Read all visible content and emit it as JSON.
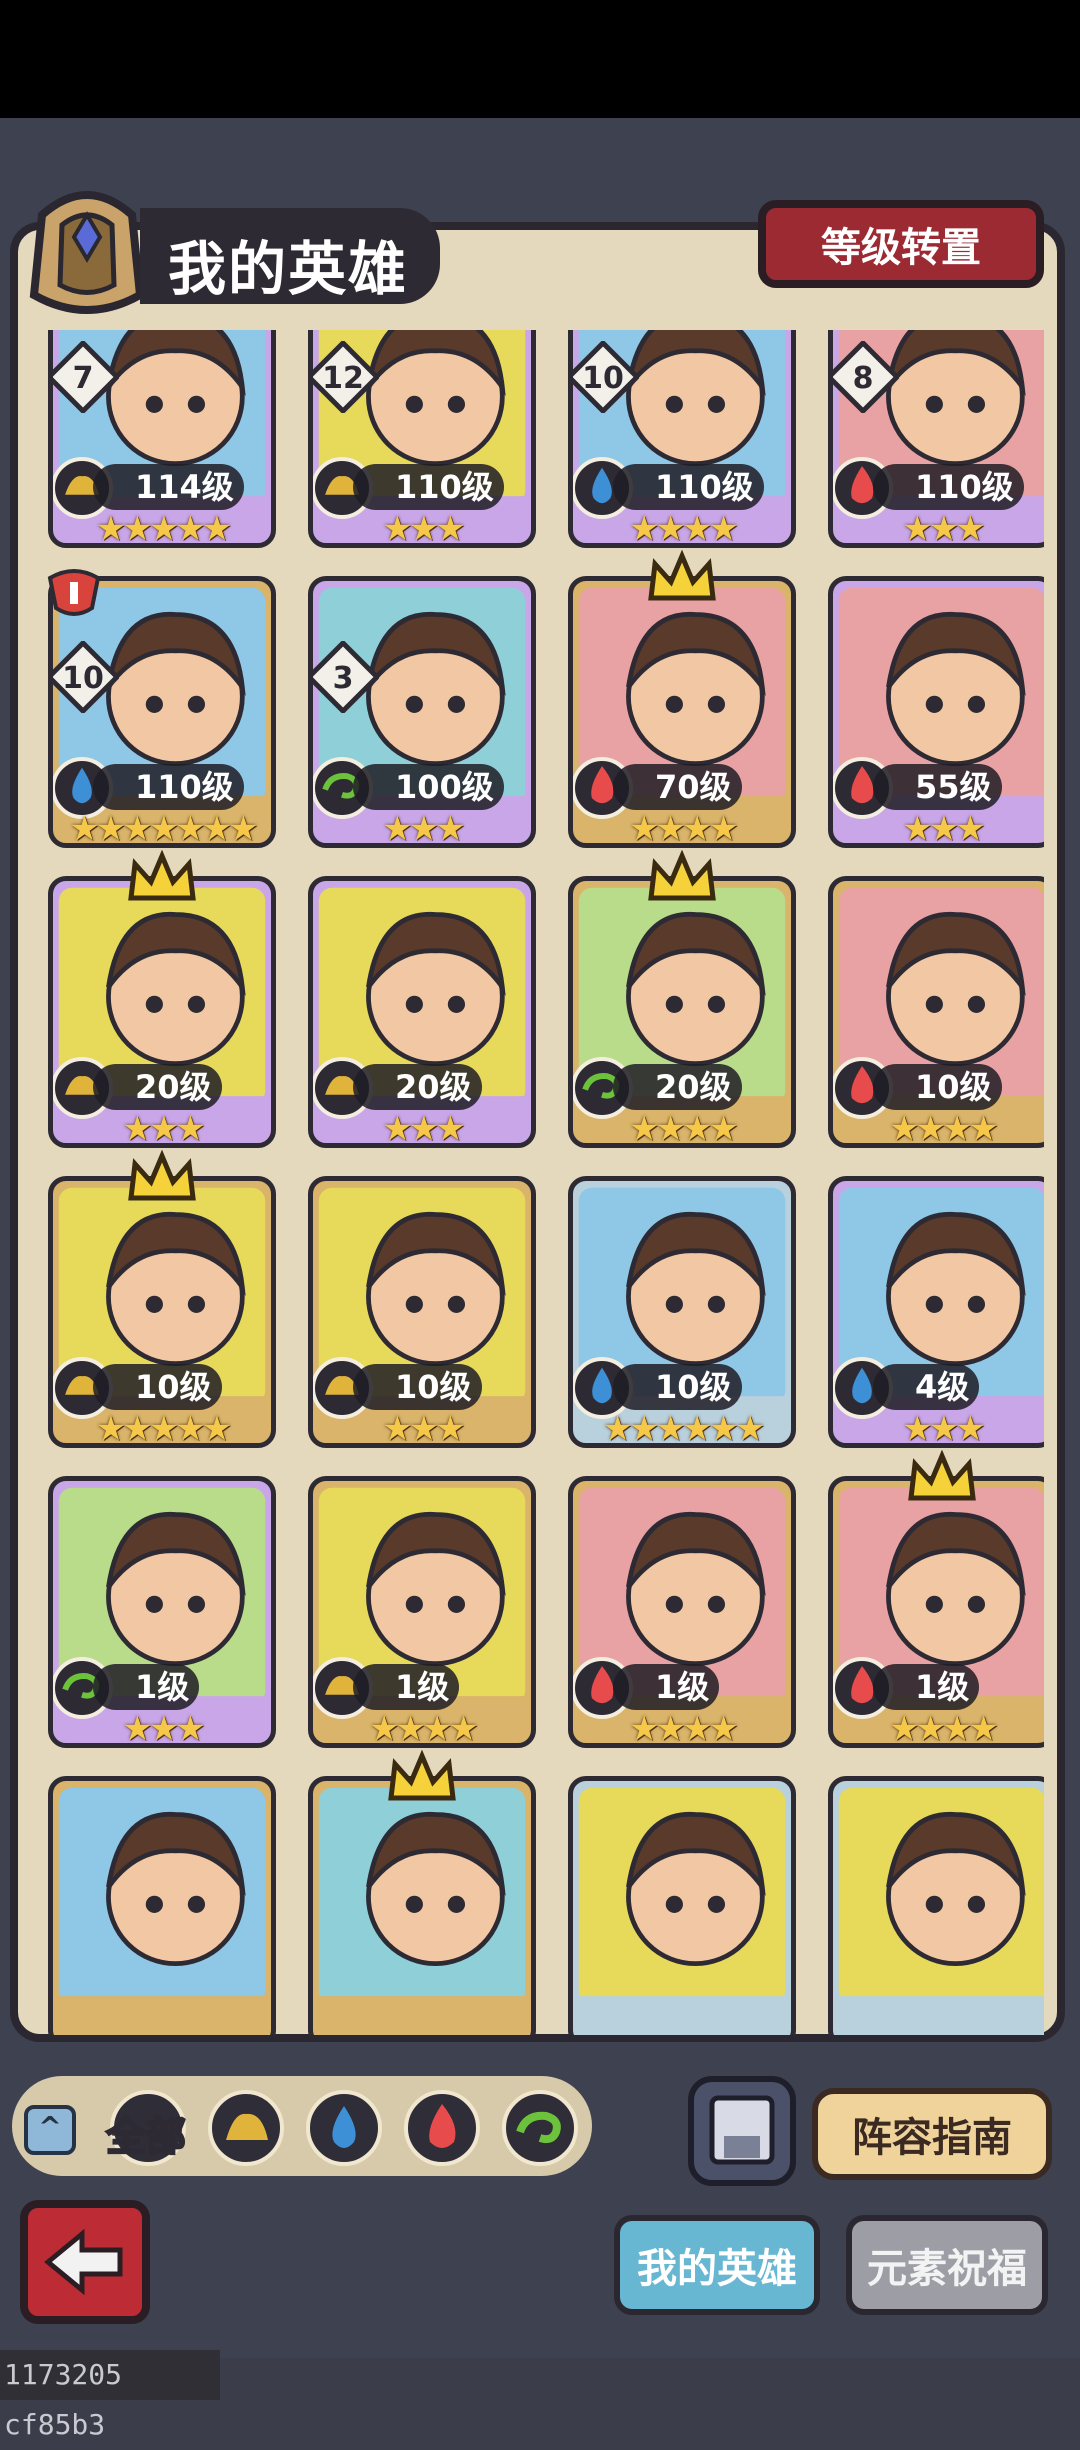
{
  "header": {
    "title": "我的英雄",
    "transfer_button": "等级转置"
  },
  "colors": {
    "fire": "#e84b4b",
    "water": "#3d8fd6",
    "earth": "#e0b33a",
    "wind": "#6cc23a"
  },
  "heroes": [
    {
      "level": "114级",
      "elem": "earth",
      "stars": "★★★★★",
      "num": "7",
      "crown": false,
      "dot": true,
      "rank": false,
      "bg": "#8fc7e6",
      "frame": "#c9a6e8"
    },
    {
      "level": "110级",
      "elem": "earth",
      "stars": "★★★",
      "num": "12",
      "crown": true,
      "dot": true,
      "rank": true,
      "bg": "#e7d95a",
      "frame": "#c9a6e8"
    },
    {
      "level": "110级",
      "elem": "water",
      "stars": "★★★★",
      "num": "10",
      "crown": false,
      "dot": true,
      "rank": false,
      "bg": "#8fc7e6",
      "frame": "#c9a6e8"
    },
    {
      "level": "110级",
      "elem": "fire",
      "stars": "★★★",
      "num": "8",
      "crown": true,
      "dot": true,
      "rank": false,
      "bg": "#e9a2a4",
      "frame": "#c9a6e8"
    },
    {
      "level": "110级",
      "elem": "water",
      "stars": "★★★★★★★",
      "num": "10",
      "crown": false,
      "dot": false,
      "rank": true,
      "bg": "#8fc7e6",
      "frame": "#d9b46a"
    },
    {
      "level": "100级",
      "elem": "wind",
      "stars": "★★★",
      "num": "3",
      "crown": false,
      "dot": false,
      "rank": false,
      "bg": "#8fd0d8",
      "frame": "#c9a6e8"
    },
    {
      "level": "70级",
      "elem": "fire",
      "stars": "★★★★",
      "num": "",
      "crown": true,
      "dot": false,
      "rank": false,
      "bg": "#e9a2a4",
      "frame": "#d9b46a"
    },
    {
      "level": "55级",
      "elem": "fire",
      "stars": "★★★",
      "num": "",
      "crown": false,
      "dot": false,
      "rank": false,
      "bg": "#e9a2a4",
      "frame": "#c9a6e8"
    },
    {
      "level": "20级",
      "elem": "earth",
      "stars": "★★★",
      "num": "",
      "crown": true,
      "dot": false,
      "rank": false,
      "bg": "#e7d95a",
      "frame": "#c9a6e8"
    },
    {
      "level": "20级",
      "elem": "earth",
      "stars": "★★★",
      "num": "",
      "crown": false,
      "dot": false,
      "rank": false,
      "bg": "#e7d95a",
      "frame": "#c9a6e8"
    },
    {
      "level": "20级",
      "elem": "wind",
      "stars": "★★★★",
      "num": "",
      "crown": true,
      "dot": false,
      "rank": false,
      "bg": "#b8dc8a",
      "frame": "#d9b46a"
    },
    {
      "level": "10级",
      "elem": "fire",
      "stars": "★★★★",
      "num": "",
      "crown": false,
      "dot": false,
      "rank": false,
      "bg": "#e9a2a4",
      "frame": "#d9b46a"
    },
    {
      "level": "10级",
      "elem": "earth",
      "stars": "★★★★★",
      "num": "",
      "crown": true,
      "dot": false,
      "rank": false,
      "bg": "#e7d95a",
      "frame": "#d9b46a"
    },
    {
      "level": "10级",
      "elem": "earth",
      "stars": "★★★",
      "num": "",
      "crown": false,
      "dot": false,
      "rank": false,
      "bg": "#e7d95a",
      "frame": "#d9b46a"
    },
    {
      "level": "10级",
      "elem": "water",
      "stars": "★★★★★★",
      "num": "",
      "crown": false,
      "dot": false,
      "rank": false,
      "bg": "#8fc7e6",
      "frame": "#b9d0dd"
    },
    {
      "level": "4级",
      "elem": "water",
      "stars": "★★★",
      "num": "",
      "crown": false,
      "dot": false,
      "rank": false,
      "bg": "#8fc7e6",
      "frame": "#c9a6e8"
    },
    {
      "level": "1级",
      "elem": "wind",
      "stars": "★★★",
      "num": "",
      "crown": false,
      "dot": false,
      "rank": false,
      "bg": "#b8dc8a",
      "frame": "#c9a6e8"
    },
    {
      "level": "1级",
      "elem": "earth",
      "stars": "★★★★",
      "num": "",
      "crown": false,
      "dot": false,
      "rank": false,
      "bg": "#e7d95a",
      "frame": "#d9b46a"
    },
    {
      "level": "1级",
      "elem": "fire",
      "stars": "★★★★",
      "num": "",
      "crown": false,
      "dot": false,
      "rank": false,
      "bg": "#e9a2a4",
      "frame": "#d9b46a"
    },
    {
      "level": "1级",
      "elem": "fire",
      "stars": "★★★★",
      "num": "",
      "crown": true,
      "dot": false,
      "rank": false,
      "bg": "#e9a2a4",
      "frame": "#d9b46a"
    },
    {
      "level": "",
      "elem": "",
      "stars": "",
      "num": "",
      "crown": false,
      "dot": false,
      "rank": false,
      "bg": "#8fc7e6",
      "frame": "#d9b46a"
    },
    {
      "level": "",
      "elem": "",
      "stars": "",
      "num": "",
      "crown": true,
      "dot": false,
      "rank": false,
      "bg": "#8fd0d8",
      "frame": "#d9b46a"
    },
    {
      "level": "",
      "elem": "",
      "stars": "",
      "num": "",
      "crown": false,
      "dot": false,
      "rank": false,
      "bg": "#e7d95a",
      "frame": "#b9d0dd"
    },
    {
      "level": "",
      "elem": "",
      "stars": "",
      "num": "",
      "crown": false,
      "dot": false,
      "rank": false,
      "bg": "#e7d95a",
      "frame": "#b9d0dd"
    }
  ],
  "filter": {
    "all_label": "全部",
    "icons": [
      "earth-filter-icon",
      "water-filter-icon",
      "fire-filter-icon",
      "wind-filter-icon"
    ]
  },
  "buttons": {
    "guide": "阵容指南"
  },
  "tabs": {
    "my_heroes": "我的英雄",
    "element_blessing": "元素祝福"
  },
  "footer": {
    "id_text": "1173205 cf85b3"
  }
}
